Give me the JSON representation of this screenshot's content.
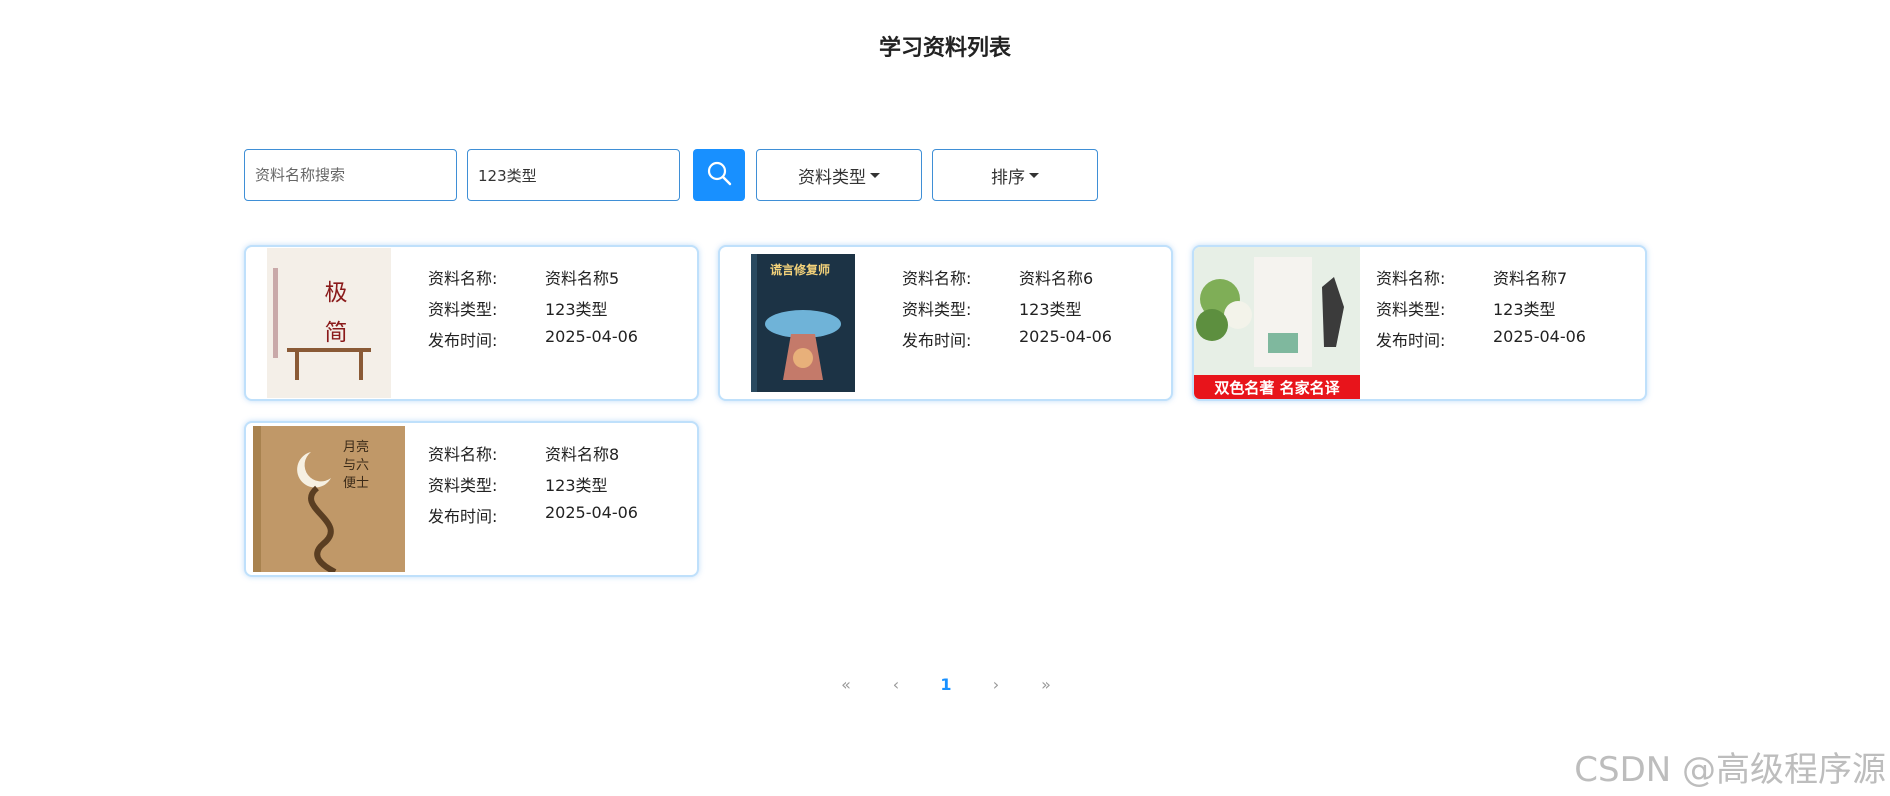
{
  "page": {
    "title": "学习资料列表"
  },
  "search": {
    "name_placeholder": "资料名称搜索",
    "name_value": "",
    "type_placeholder": "资料类型",
    "type_value": "123类型",
    "type_dropdown_label": "资料类型",
    "sort_dropdown_label": "排序",
    "button_icon": "search-icon"
  },
  "labels": {
    "name": "资料名称:",
    "type": "资料类型:",
    "date": "发布时间:"
  },
  "items": [
    {
      "name": "资料名称5",
      "type": "123类型",
      "date": "2025-04-06",
      "cover": {
        "title_line1": "极",
        "title_line2": "简",
        "bg": "#f4efe8",
        "text": "#8a1a1a"
      }
    },
    {
      "name": "资料名称6",
      "type": "123类型",
      "date": "2025-04-06",
      "cover": {
        "title": "谎言修复师",
        "bg": "#1c3345",
        "text": "#f3d27a"
      }
    },
    {
      "name": "资料名称7",
      "type": "123类型",
      "date": "2025-04-06",
      "cover": {
        "banner": "双色名著 名家名译",
        "bg": "#e7efe6",
        "banner_bg": "#e8141b"
      }
    },
    {
      "name": "资料名称8",
      "type": "123类型",
      "date": "2025-04-06",
      "cover": {
        "title": "月亮与六便士",
        "bg": "#c09868",
        "text": "#3a2a18"
      }
    }
  ],
  "pagination": {
    "first": "«",
    "prev": "‹",
    "current": "1",
    "next": "›",
    "last": "»"
  },
  "watermark": "CSDN @高级程序源",
  "colors": {
    "accent": "#1890ff",
    "border": "#3f8fd6",
    "card_border": "#bfe0fb"
  }
}
